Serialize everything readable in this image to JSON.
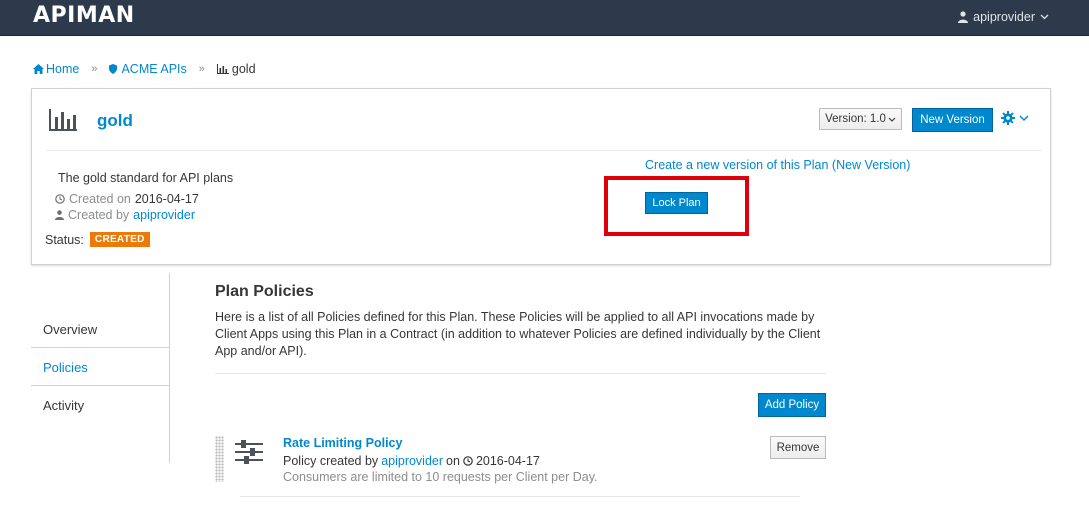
{
  "app": {
    "logo_text": "APIMAN",
    "user_name": "apiprovider"
  },
  "breadcrumb": {
    "home": "Home",
    "org": "ACME APIs",
    "current": "gold"
  },
  "plan": {
    "name": "gold",
    "version_label": "Version: 1.0",
    "new_version_label": "New Version",
    "description": "The gold standard for API plans",
    "created_on_label": "Created on",
    "created_on_value": "2016-04-17",
    "created_by_label": "Created by",
    "created_by_value": "apiprovider",
    "status_label": "Status:",
    "status_value": "CREATED",
    "create_version_link": "Create a new version of this Plan (New Version)",
    "lock_label": "Lock Plan"
  },
  "sidenav": {
    "items": [
      {
        "label": "Overview"
      },
      {
        "label": "Policies"
      },
      {
        "label": "Activity"
      }
    ]
  },
  "main": {
    "title": "Plan Policies",
    "intro": "Here is a list of all Policies defined for this Plan. These Policies will be applied to all API invocations made by Client Apps using this Plan in a Contract (in addition to whatever Policies are defined individually by the Client App and/or API).",
    "add_policy_label": "Add Policy"
  },
  "policies": [
    {
      "name": "Rate Limiting Policy",
      "created_by_prefix": "Policy created by",
      "created_by": "apiprovider",
      "on_label": "on",
      "date": "2016-04-17",
      "description": "Consumers are limited to 10 requests per Client per Day.",
      "remove_label": "Remove"
    }
  ],
  "colors": {
    "topbar": "#2c3a4c",
    "primary": "#0088ce",
    "status_badge": "#ec7a08",
    "highlight": "#e0000b"
  }
}
